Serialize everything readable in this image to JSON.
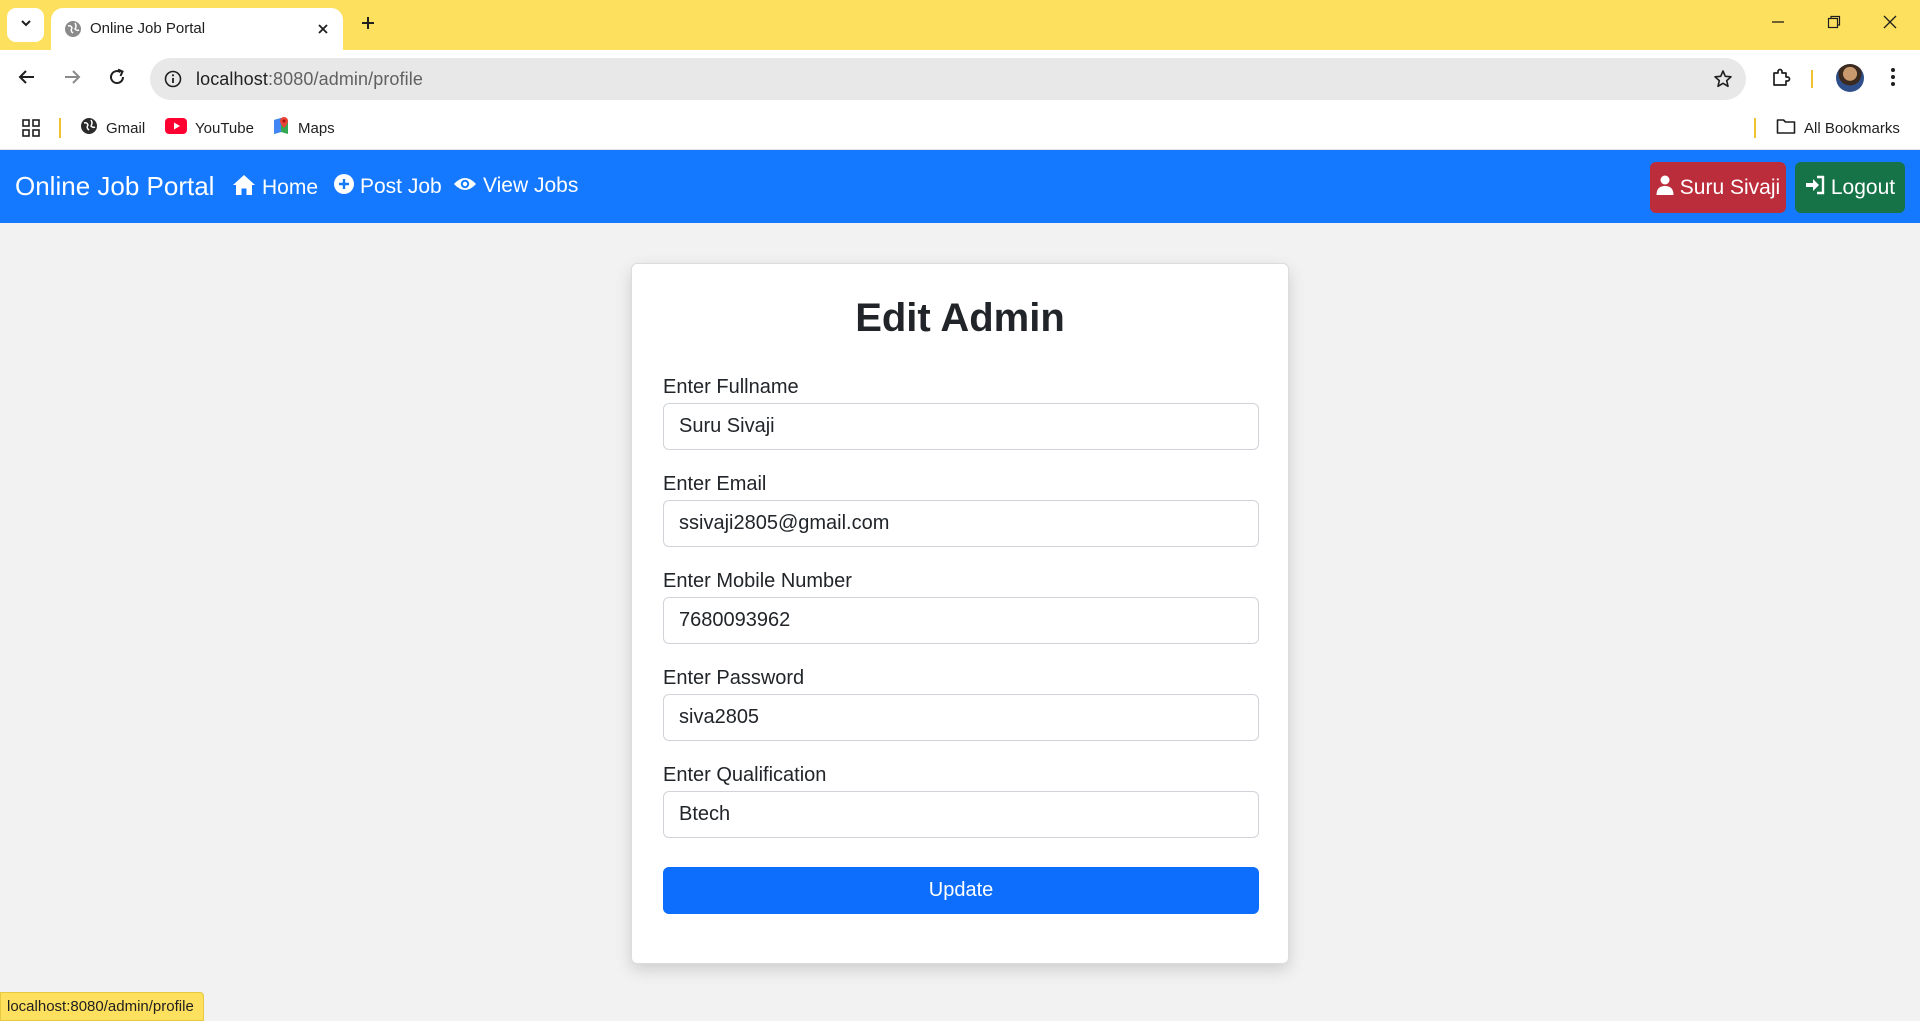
{
  "browser": {
    "tab_title": "Online Job Portal",
    "url_host": "localhost",
    "url_path": ":8080/admin/profile",
    "bookmarks": [
      {
        "label": "Gmail",
        "icon": "globe-icon"
      },
      {
        "label": "YouTube",
        "icon": "youtube-icon"
      },
      {
        "label": "Maps",
        "icon": "maps-icon"
      }
    ],
    "all_bookmarks_label": "All Bookmarks",
    "status_url": "localhost:8080/admin/profile"
  },
  "navbar": {
    "brand": "Online Job Portal",
    "links": [
      {
        "label": "Home",
        "icon": "home-icon"
      },
      {
        "label": "Post Job",
        "icon": "plus-circle-icon"
      },
      {
        "label": "View Jobs",
        "icon": "eye-icon"
      }
    ],
    "user_label": "Suru Sivaji",
    "logout_label": "Logout",
    "colors": {
      "navbar": "#1479ff",
      "user_button": "#bb2d3b",
      "logout_button": "#157347"
    }
  },
  "form": {
    "title": "Edit Admin",
    "fields": [
      {
        "label": "Enter Fullname",
        "value": "Suru Sivaji"
      },
      {
        "label": "Enter Email",
        "value": "ssivaji2805@gmail.com"
      },
      {
        "label": "Enter Mobile Number",
        "value": "7680093962"
      },
      {
        "label": "Enter Password",
        "value": "siva2805"
      },
      {
        "label": "Enter Qualification",
        "value": "Btech"
      }
    ],
    "submit_label": "Update",
    "submit_color": "#0d6efd"
  }
}
